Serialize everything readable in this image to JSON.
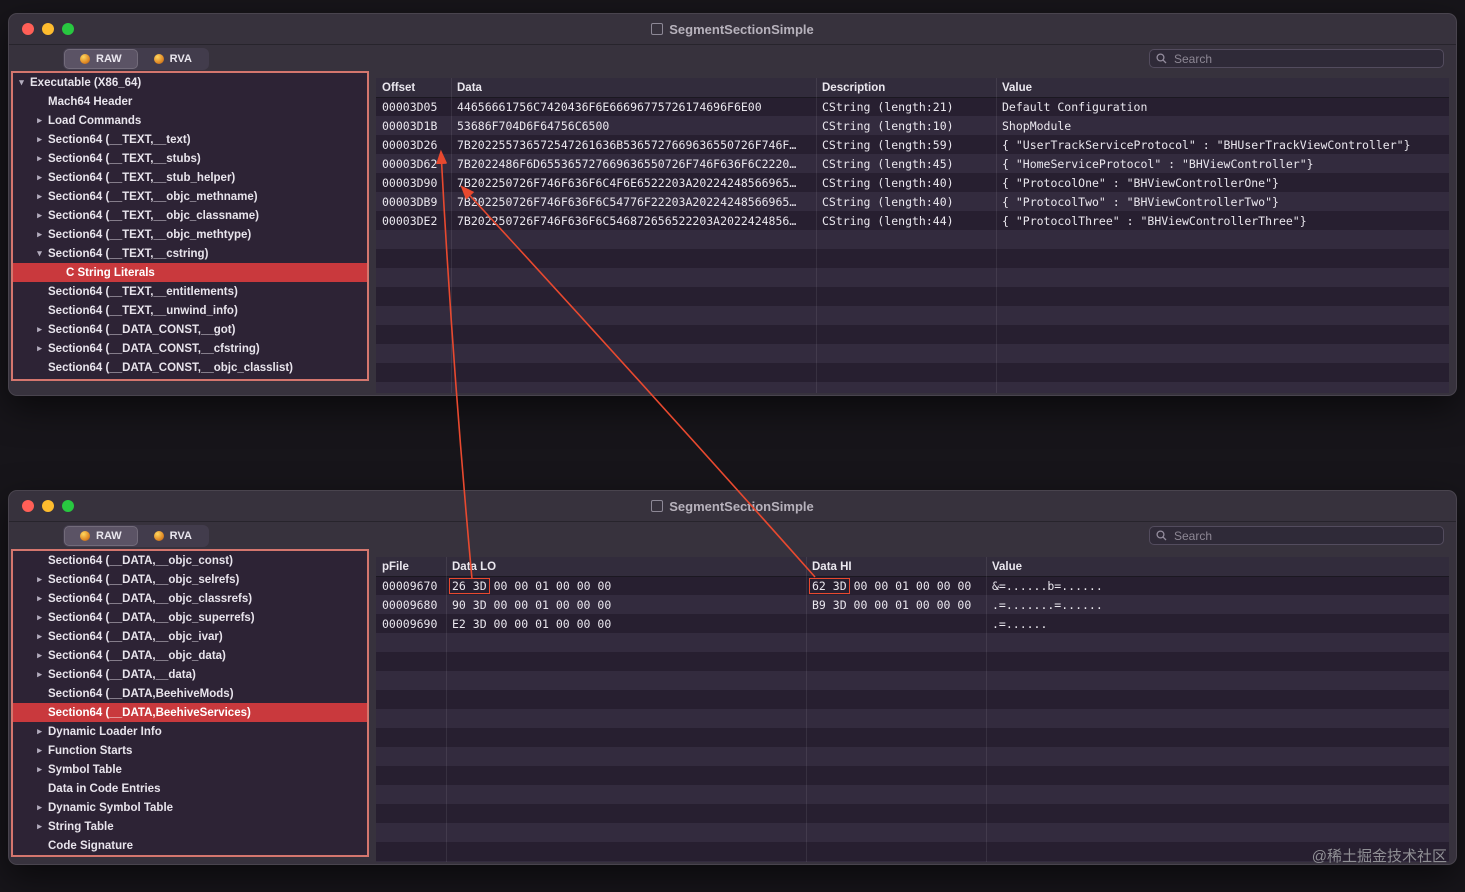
{
  "colors": {
    "selection_red": "#c9393d",
    "border_red": "#d4766e",
    "annotation": "#e8492f"
  },
  "page": {
    "watermark": "@稀土掘金技术社区"
  },
  "windows": {
    "top": {
      "title": "SegmentSectionSimple",
      "toolbar": {
        "raw": "RAW",
        "rva": "RVA",
        "search_placeholder": "Search"
      },
      "sidebar": [
        {
          "label": "Executable (X86_64)",
          "depth": 0,
          "chevron": "down"
        },
        {
          "label": "Mach64 Header",
          "depth": 1,
          "chevron": "none"
        },
        {
          "label": "Load Commands",
          "depth": 1,
          "chevron": "right"
        },
        {
          "label": "Section64 (__TEXT,__text)",
          "depth": 1,
          "chevron": "right"
        },
        {
          "label": "Section64 (__TEXT,__stubs)",
          "depth": 1,
          "chevron": "right"
        },
        {
          "label": "Section64 (__TEXT,__stub_helper)",
          "depth": 1,
          "chevron": "right"
        },
        {
          "label": "Section64 (__TEXT,__objc_methname)",
          "depth": 1,
          "chevron": "right"
        },
        {
          "label": "Section64 (__TEXT,__objc_classname)",
          "depth": 1,
          "chevron": "right"
        },
        {
          "label": "Section64 (__TEXT,__objc_methtype)",
          "depth": 1,
          "chevron": "right"
        },
        {
          "label": "Section64 (__TEXT,__cstring)",
          "depth": 1,
          "chevron": "down"
        },
        {
          "label": "C String Literals",
          "depth": 2,
          "chevron": "none",
          "selected": true
        },
        {
          "label": "Section64 (__TEXT,__entitlements)",
          "depth": 1,
          "chevron": "none"
        },
        {
          "label": "Section64 (__TEXT,__unwind_info)",
          "depth": 1,
          "chevron": "none"
        },
        {
          "label": "Section64 (__DATA_CONST,__got)",
          "depth": 1,
          "chevron": "right"
        },
        {
          "label": "Section64 (__DATA_CONST,__cfstring)",
          "depth": 1,
          "chevron": "right"
        },
        {
          "label": "Section64 (__DATA_CONST,__objc_classlist)",
          "depth": 1,
          "chevron": "none"
        }
      ],
      "table": {
        "columns": [
          "Offset",
          "Data",
          "Description",
          "Value"
        ],
        "rows": [
          [
            "00003D05",
            "44656661756C7420436F6E66696775726174696F6E00",
            "CString (length:21)",
            "Default Configuration"
          ],
          [
            "00003D1B",
            "53686F704D6F64756C6500",
            "CString (length:10)",
            "ShopModule"
          ],
          [
            "00003D26",
            "7B202255736572547261636B5365727669636550726F746F…",
            "CString (length:59)",
            "{ \"UserTrackServiceProtocol\" : \"BHUserTrackViewController\"}"
          ],
          [
            "00003D62",
            "7B2022486F6D655365727669636550726F746F636F6C2220…",
            "CString (length:45)",
            "{ \"HomeServiceProtocol\" : \"BHViewController\"}"
          ],
          [
            "00003D90",
            "7B202250726F746F636F6C4F6E6522203A20224248566965…",
            "CString (length:40)",
            "{ \"ProtocolOne\" : \"BHViewControllerOne\"}"
          ],
          [
            "00003DB9",
            "7B202250726F746F636F6C54776F22203A20224248566965…",
            "CString (length:40)",
            "{ \"ProtocolTwo\" : \"BHViewControllerTwo\"}"
          ],
          [
            "00003DE2",
            "7B202250726F746F636F6C546872656522203A2022424856…",
            "CString (length:44)",
            "{ \"ProtocolThree\" : \"BHViewControllerThree\"}"
          ]
        ]
      }
    },
    "bottom": {
      "title": "SegmentSectionSimple",
      "toolbar": {
        "raw": "RAW",
        "rva": "RVA",
        "search_placeholder": "Search"
      },
      "sidebar": [
        {
          "label": "Section64 (__DATA,__objc_const)",
          "depth": 1,
          "chevron": "none"
        },
        {
          "label": "Section64 (__DATA,__objc_selrefs)",
          "depth": 1,
          "chevron": "right"
        },
        {
          "label": "Section64 (__DATA,__objc_classrefs)",
          "depth": 1,
          "chevron": "right"
        },
        {
          "label": "Section64 (__DATA,__objc_superrefs)",
          "depth": 1,
          "chevron": "right"
        },
        {
          "label": "Section64 (__DATA,__objc_ivar)",
          "depth": 1,
          "chevron": "right"
        },
        {
          "label": "Section64 (__DATA,__objc_data)",
          "depth": 1,
          "chevron": "right"
        },
        {
          "label": "Section64 (__DATA,__data)",
          "depth": 1,
          "chevron": "right"
        },
        {
          "label": "Section64 (__DATA,BeehiveMods)",
          "depth": 1,
          "chevron": "none"
        },
        {
          "label": "Section64 (__DATA,BeehiveServices)",
          "depth": 1,
          "chevron": "none",
          "selected": true
        },
        {
          "label": "Dynamic Loader Info",
          "depth": 1,
          "chevron": "right"
        },
        {
          "label": "Function Starts",
          "depth": 1,
          "chevron": "right"
        },
        {
          "label": "Symbol Table",
          "depth": 1,
          "chevron": "right"
        },
        {
          "label": "Data in Code Entries",
          "depth": 1,
          "chevron": "none"
        },
        {
          "label": "Dynamic Symbol Table",
          "depth": 1,
          "chevron": "right"
        },
        {
          "label": "String Table",
          "depth": 1,
          "chevron": "right"
        },
        {
          "label": "Code Signature",
          "depth": 1,
          "chevron": "none"
        }
      ],
      "table": {
        "columns": [
          "pFile",
          "Data LO",
          "Data HI",
          "Value"
        ],
        "rows": [
          [
            "00009670",
            {
              "box": "26 3D",
              "rest": "00 00 01 00 00 00"
            },
            {
              "box": "62 3D",
              "rest": "00 00 01 00 00 00"
            },
            "&=......b=......"
          ],
          [
            "00009680",
            "90 3D 00 00 01 00 00 00",
            "B9 3D 00 00 01 00 00 00",
            ".=.......=......"
          ],
          [
            "00009690",
            "E2 3D 00 00 01 00 00 00",
            "",
            ".=......"
          ]
        ]
      }
    }
  }
}
